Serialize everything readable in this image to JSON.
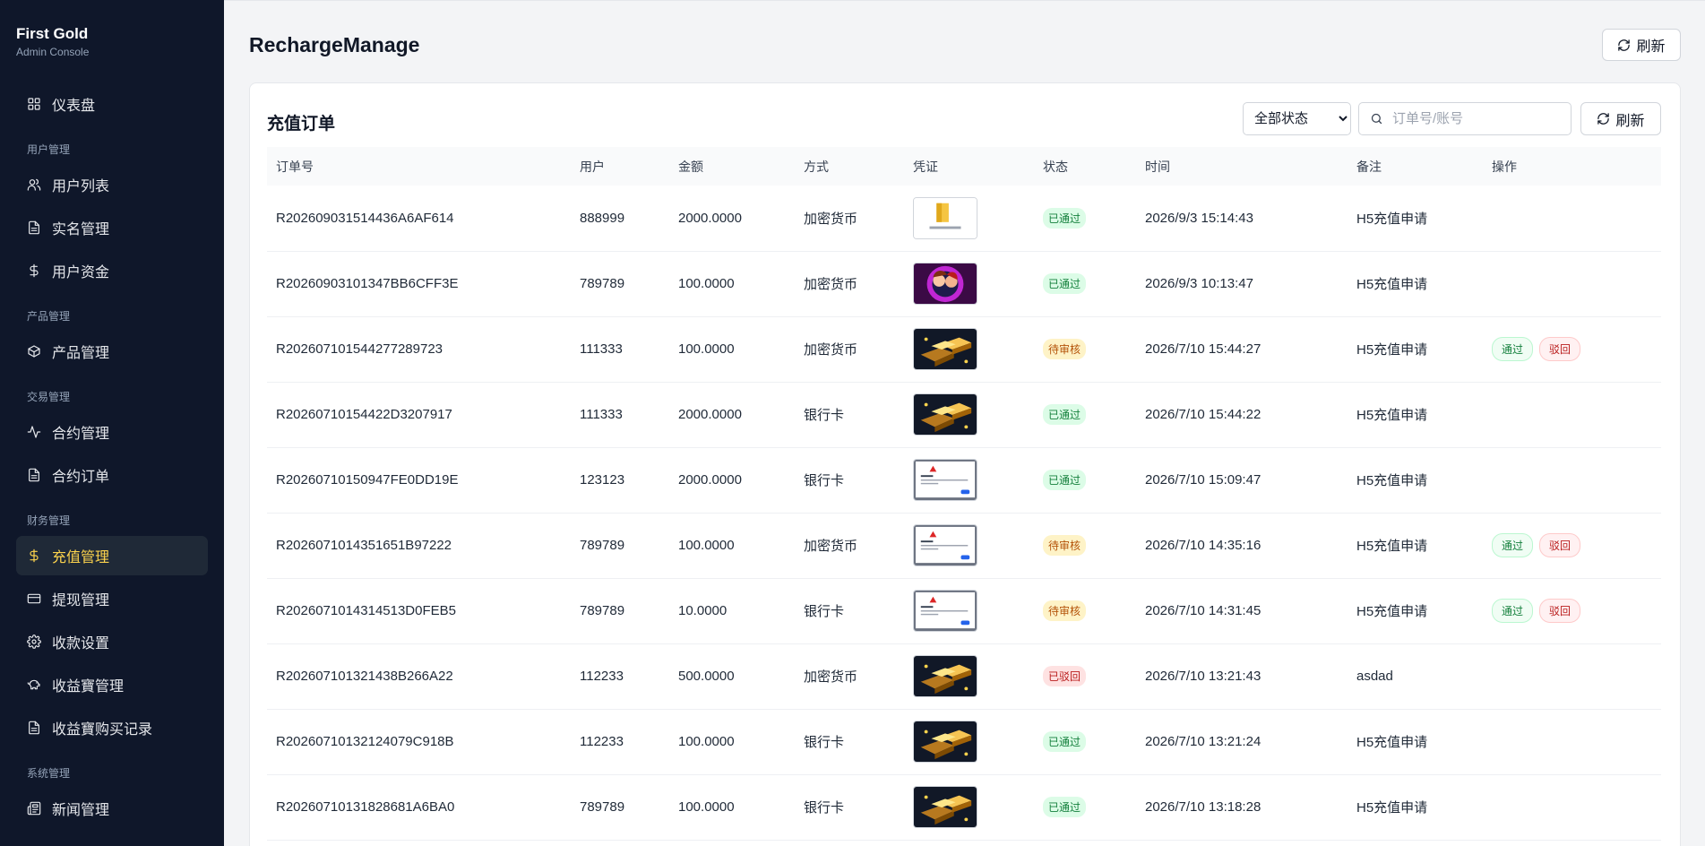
{
  "brand": {
    "title": "First Gold",
    "subtitle": "Admin Console"
  },
  "sidebar": {
    "items": [
      {
        "type": "item",
        "label": "仪表盘",
        "icon": "dashboard-icon"
      },
      {
        "type": "group",
        "label": "用户管理"
      },
      {
        "type": "item",
        "label": "用户列表",
        "icon": "users-icon"
      },
      {
        "type": "item",
        "label": "实名管理",
        "icon": "document-icon"
      },
      {
        "type": "item",
        "label": "用户资金",
        "icon": "dollar-icon"
      },
      {
        "type": "group",
        "label": "产品管理"
      },
      {
        "type": "item",
        "label": "产品管理",
        "icon": "box-icon"
      },
      {
        "type": "group",
        "label": "交易管理"
      },
      {
        "type": "item",
        "label": "合约管理",
        "icon": "activity-icon"
      },
      {
        "type": "item",
        "label": "合约订单",
        "icon": "document-icon"
      },
      {
        "type": "group",
        "label": "财务管理"
      },
      {
        "type": "item",
        "label": "充值管理",
        "icon": "dollar-icon",
        "active": true
      },
      {
        "type": "item",
        "label": "提现管理",
        "icon": "card-icon"
      },
      {
        "type": "item",
        "label": "收款设置",
        "icon": "gear-icon"
      },
      {
        "type": "item",
        "label": "收益寶管理",
        "icon": "piggy-bank-icon"
      },
      {
        "type": "item",
        "label": "收益寶购买记录",
        "icon": "document-icon"
      },
      {
        "type": "group",
        "label": "系统管理"
      },
      {
        "type": "item",
        "label": "新闻管理",
        "icon": "news-icon"
      }
    ]
  },
  "header": {
    "title": "RechargeManage",
    "refresh_label": "刷新"
  },
  "card": {
    "title": "充值订单",
    "status_filter": {
      "selected": "全部状态"
    },
    "search": {
      "placeholder": "订单号/账号",
      "value": ""
    },
    "refresh_label": "刷新"
  },
  "table": {
    "columns": [
      "订单号",
      "用户",
      "金额",
      "方式",
      "凭证",
      "状态",
      "时间",
      "备注",
      "操作"
    ],
    "rows": [
      {
        "order_no": "R202609031514436A6AF614",
        "user": "888999",
        "amount": "2000.0000",
        "method": "加密货币",
        "voucher": "folder",
        "status": "已通过",
        "status_kind": "ok",
        "time": "2026/9/3 15:14:43",
        "note": "H5充值申请",
        "actions": []
      },
      {
        "order_no": "R20260903101347BB6CFF3E",
        "user": "789789",
        "amount": "100.0000",
        "method": "加密货币",
        "voucher": "portrait",
        "status": "已通过",
        "status_kind": "ok",
        "time": "2026/9/3 10:13:47",
        "note": "H5充值申请",
        "actions": []
      },
      {
        "order_no": "R202607101544277289723",
        "user": "111333",
        "amount": "100.0000",
        "method": "加密货币",
        "voucher": "gold",
        "status": "待审核",
        "status_kind": "pending",
        "time": "2026/7/10 15:44:27",
        "note": "H5充值申请",
        "actions": [
          "通过",
          "驳回"
        ]
      },
      {
        "order_no": "R20260710154422D3207917",
        "user": "111333",
        "amount": "2000.0000",
        "method": "银行卡",
        "voucher": "gold",
        "status": "已通过",
        "status_kind": "ok",
        "time": "2026/7/10 15:44:22",
        "note": "H5充值申请",
        "actions": []
      },
      {
        "order_no": "R20260710150947FE0DD19E",
        "user": "123123",
        "amount": "2000.0000",
        "method": "银行卡",
        "voucher": "dialog",
        "status": "已通过",
        "status_kind": "ok",
        "time": "2026/7/10 15:09:47",
        "note": "H5充值申请",
        "actions": []
      },
      {
        "order_no": "R2026071014351651B97222",
        "user": "789789",
        "amount": "100.0000",
        "method": "加密货币",
        "voucher": "dialog",
        "status": "待审核",
        "status_kind": "pending",
        "time": "2026/7/10 14:35:16",
        "note": "H5充值申请",
        "actions": [
          "通过",
          "驳回"
        ]
      },
      {
        "order_no": "R2026071014314513D0FEB5",
        "user": "789789",
        "amount": "10.0000",
        "method": "银行卡",
        "voucher": "dialog",
        "status": "待审核",
        "status_kind": "pending",
        "time": "2026/7/10 14:31:45",
        "note": "H5充值申请",
        "actions": [
          "通过",
          "驳回"
        ]
      },
      {
        "order_no": "R202607101321438B266A22",
        "user": "112233",
        "amount": "500.0000",
        "method": "加密货币",
        "voucher": "gold",
        "status": "已驳回",
        "status_kind": "rejected",
        "time": "2026/7/10 13:21:43",
        "note": "asdad",
        "actions": []
      },
      {
        "order_no": "R20260710132124079C918B",
        "user": "112233",
        "amount": "100.0000",
        "method": "银行卡",
        "voucher": "gold",
        "status": "已通过",
        "status_kind": "ok",
        "time": "2026/7/10 13:21:24",
        "note": "H5充值申请",
        "actions": []
      },
      {
        "order_no": "R20260710131828681A6BA0",
        "user": "789789",
        "amount": "100.0000",
        "method": "银行卡",
        "voucher": "gold",
        "status": "已通过",
        "status_kind": "ok",
        "time": "2026/7/10 13:18:28",
        "note": "H5充值申请",
        "actions": []
      }
    ]
  },
  "colors": {
    "sidebar_bg": "#0f172a",
    "active_text": "#fcd34d",
    "approve": "#15803d",
    "reject": "#b91c1c",
    "pending": "#b45309"
  }
}
